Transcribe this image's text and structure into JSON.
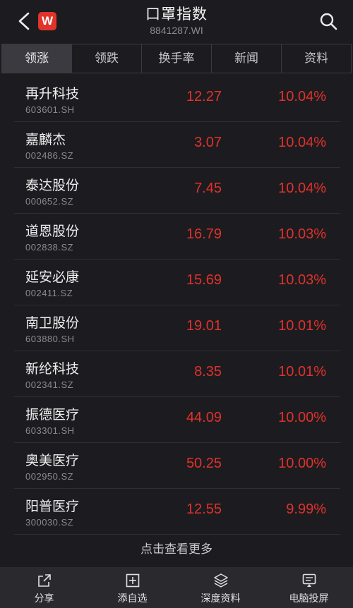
{
  "header": {
    "title": "口罩指数",
    "code": "8841287.WI",
    "logo_text": "W",
    "back_icon": "chevron-left-icon",
    "search_icon": "search-icon"
  },
  "tabs": [
    {
      "label": "领涨"
    },
    {
      "label": "领跌"
    },
    {
      "label": "换手率"
    },
    {
      "label": "新闻"
    },
    {
      "label": "资料"
    }
  ],
  "stocks": [
    {
      "name": "再升科技",
      "code": "603601.SH",
      "price": "12.27",
      "change": "10.04%"
    },
    {
      "name": "嘉麟杰",
      "code": "002486.SZ",
      "price": "3.07",
      "change": "10.04%"
    },
    {
      "name": "泰达股份",
      "code": "000652.SZ",
      "price": "7.45",
      "change": "10.04%"
    },
    {
      "name": "道恩股份",
      "code": "002838.SZ",
      "price": "16.79",
      "change": "10.03%"
    },
    {
      "name": "延安必康",
      "code": "002411.SZ",
      "price": "15.69",
      "change": "10.03%"
    },
    {
      "name": "南卫股份",
      "code": "603880.SH",
      "price": "19.01",
      "change": "10.01%"
    },
    {
      "name": "新纶科技",
      "code": "002341.SZ",
      "price": "8.35",
      "change": "10.01%"
    },
    {
      "name": "振德医疗",
      "code": "603301.SH",
      "price": "44.09",
      "change": "10.00%"
    },
    {
      "name": "奥美医疗",
      "code": "002950.SZ",
      "price": "50.25",
      "change": "10.00%"
    },
    {
      "name": "阳普医疗",
      "code": "300030.SZ",
      "price": "12.55",
      "change": "9.99%"
    }
  ],
  "more_label": "点击查看更多",
  "bottom_bar": [
    {
      "label": "分享",
      "icon": "share-icon"
    },
    {
      "label": "添自选",
      "icon": "add-watchlist-icon"
    },
    {
      "label": "深度资料",
      "icon": "layers-icon"
    },
    {
      "label": "电脑投屏",
      "icon": "cast-screen-icon"
    }
  ],
  "colors": {
    "background": "#1c1c20",
    "up": "#e2312a",
    "brand": "#e0342b"
  }
}
